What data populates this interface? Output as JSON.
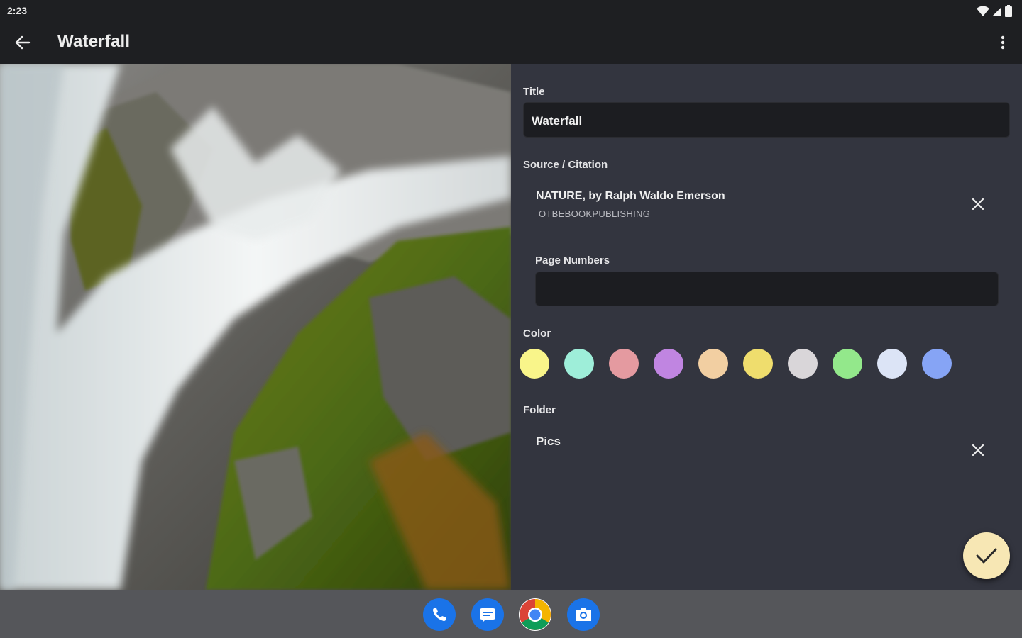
{
  "status_bar": {
    "time": "2:23"
  },
  "app_bar": {
    "title": "Waterfall"
  },
  "photo": {
    "subject": "waterfall-photo"
  },
  "form": {
    "title_label": "Title",
    "title_value": "Waterfall",
    "source_label": "Source / Citation",
    "source_title": "NATURE, by Ralph Waldo Emerson",
    "source_publisher": "OTBEBOOKPUBLISHING",
    "page_numbers_label": "Page Numbers",
    "page_numbers_value": "",
    "color_label": "Color",
    "colors": [
      "#f9f58a",
      "#9eeed9",
      "#e49aa0",
      "#c085e1",
      "#f2cfa2",
      "#efdd6d",
      "#d9d6d9",
      "#93e88b",
      "#dce4f6",
      "#86a4f5"
    ],
    "folder_label": "Folder",
    "folder_value": "Pics"
  },
  "dock": {
    "apps": [
      "phone-app-icon",
      "messages-app-icon",
      "chrome-app-icon",
      "camera-app-icon"
    ]
  },
  "accent_colors": {
    "fab": "#f7e7b4",
    "panel": "#33353f",
    "app_bar": "#1e1f22"
  }
}
